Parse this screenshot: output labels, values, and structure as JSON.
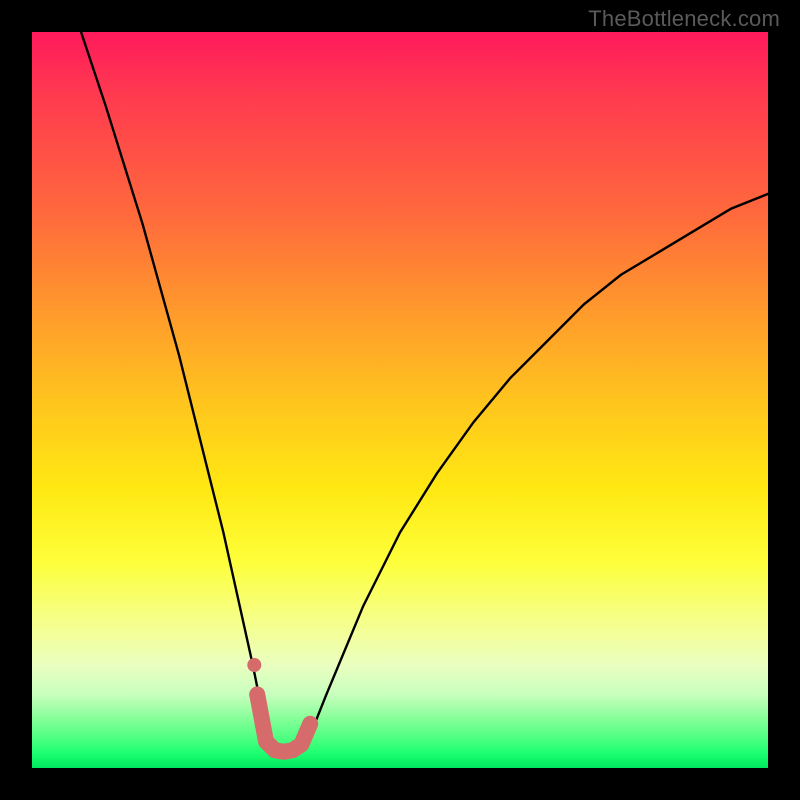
{
  "watermark": "TheBottleneck.com",
  "chart_data": {
    "type": "line",
    "title": "",
    "xlabel": "",
    "ylabel": "",
    "xlim": [
      0,
      100
    ],
    "ylim": [
      0,
      100
    ],
    "series": [
      {
        "name": "bottleneck-curve",
        "x": [
          5,
          10,
          15,
          20,
          22,
          24,
          26,
          28,
          30,
          31,
          32,
          33,
          34,
          35,
          36,
          37,
          38,
          40,
          45,
          50,
          55,
          60,
          65,
          70,
          75,
          80,
          85,
          90,
          95,
          100
        ],
        "values": [
          105,
          90,
          74,
          56,
          48,
          40,
          32,
          23,
          14,
          9,
          5,
          3,
          2,
          2,
          2,
          3,
          5,
          10,
          22,
          32,
          40,
          47,
          53,
          58,
          63,
          67,
          70,
          73,
          76,
          78
        ]
      }
    ],
    "highlight": {
      "name": "sweet-spot",
      "color": "#d66b6b",
      "points_x": [
        30.6,
        31.8,
        33.0,
        34.2,
        35.4,
        36.6,
        37.8
      ],
      "points_y": [
        10.0,
        3.6,
        2.4,
        2.2,
        2.4,
        3.2,
        6.0
      ]
    },
    "gradient_stops": [
      {
        "pos": 0,
        "color": "#ff1a5c"
      },
      {
        "pos": 25,
        "color": "#ff6a3c"
      },
      {
        "pos": 50,
        "color": "#ffc41e"
      },
      {
        "pos": 72,
        "color": "#fdff3a"
      },
      {
        "pos": 90,
        "color": "#c8ffbe"
      },
      {
        "pos": 100,
        "color": "#00e85e"
      }
    ]
  }
}
